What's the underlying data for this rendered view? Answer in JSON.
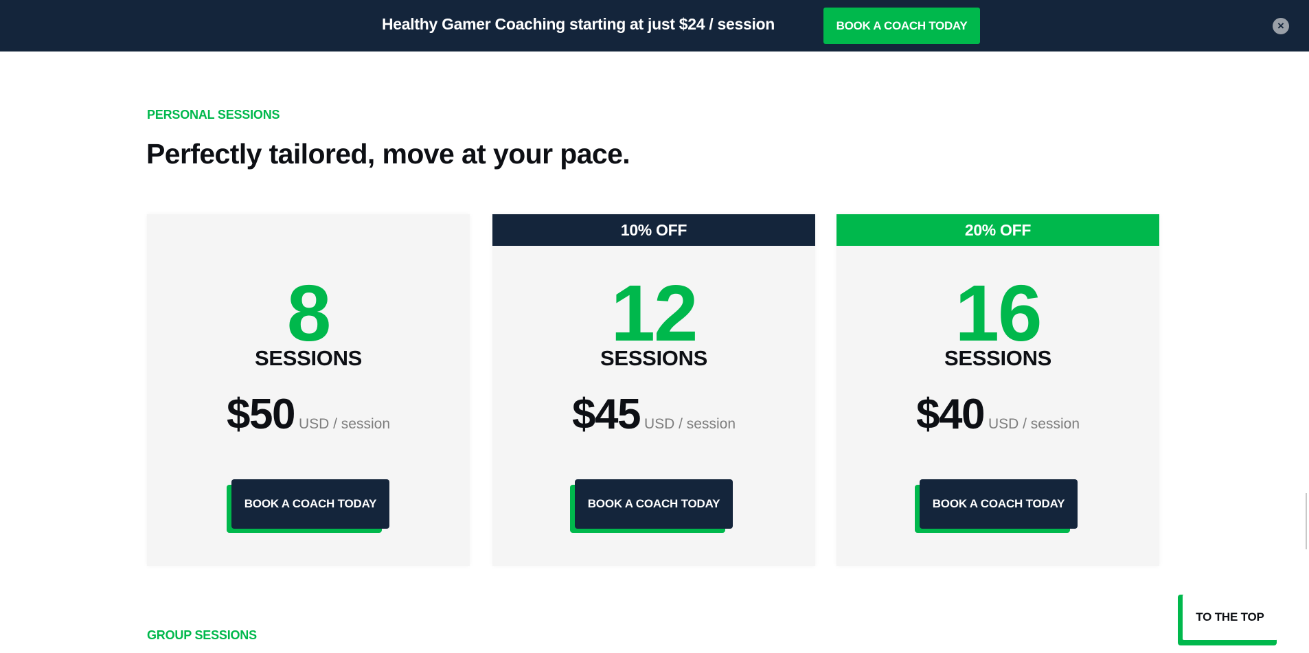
{
  "banner": {
    "text": "Healthy Gamer Coaching starting at just $24 / session",
    "cta_label": "BOOK A COACH TODAY",
    "close_glyph": "×"
  },
  "personal": {
    "eyebrow": "PERSONAL SESSIONS",
    "headline": "Perfectly tailored, move at your pace."
  },
  "cards": [
    {
      "discount": "",
      "count": "8",
      "unit": "SESSIONS",
      "price": "$50",
      "per": "USD / session",
      "cta": "BOOK A COACH TODAY"
    },
    {
      "discount": "10% OFF",
      "count": "12",
      "unit": "SESSIONS",
      "price": "$45",
      "per": "USD / session",
      "cta": "BOOK A COACH TODAY"
    },
    {
      "discount": "20% OFF",
      "count": "16",
      "unit": "SESSIONS",
      "price": "$40",
      "per": "USD / session",
      "cta": "BOOK A COACH TODAY"
    }
  ],
  "group": {
    "eyebrow": "GROUP SESSIONS"
  },
  "to_top": {
    "label": "TO THE TOP"
  },
  "colors": {
    "navy": "#14253b",
    "green": "#00b84c",
    "card_bg": "#f5f5f5",
    "muted": "#7d7d7d"
  },
  "icons": {
    "close": "close-icon"
  }
}
